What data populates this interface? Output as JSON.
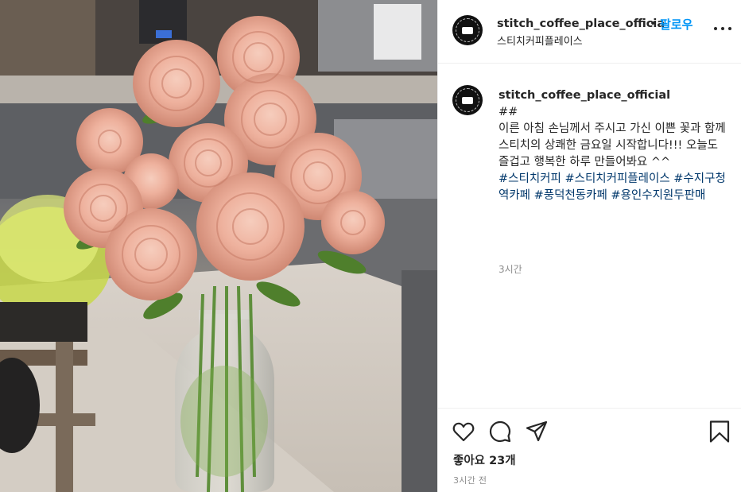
{
  "post": {
    "image_subject": "peach-roses-in-glass-vase"
  },
  "header": {
    "username": "stitch_coffee_place_officia",
    "separator": "•",
    "follow_label": "팔로우",
    "subtitle": "스티치커피플레이스",
    "avatar_icon": "coffee-logo-icon",
    "more_icon": "more-options-icon"
  },
  "caption": {
    "username": "stitch_coffee_place_official",
    "lines": [
      "##",
      "이른 아침 손님께서 주시고 가신 이쁜 꽃과 함께",
      "스티치의 상쾌한 금요일 시작합니다!!! 오늘도 즐겁고 행복한 하루 만들어봐요 ^^"
    ],
    "hashtags": "#스티치커피 #스티치커피플레이스 #수지구청역카페 #풍덕천동카페 #용인수지원두판매",
    "time": "3시간"
  },
  "actions": {
    "like_icon": "heart-icon",
    "comment_icon": "comment-icon",
    "share_icon": "send-icon",
    "save_icon": "bookmark-icon",
    "likes_text": "좋아요 23개",
    "time_ago": "3시간 전"
  },
  "colors": {
    "link_blue": "#0095f6",
    "hashtag_blue": "#00376b",
    "muted_gray": "#8e8e8e",
    "border": "#efefef",
    "rose": "#e9a894"
  }
}
